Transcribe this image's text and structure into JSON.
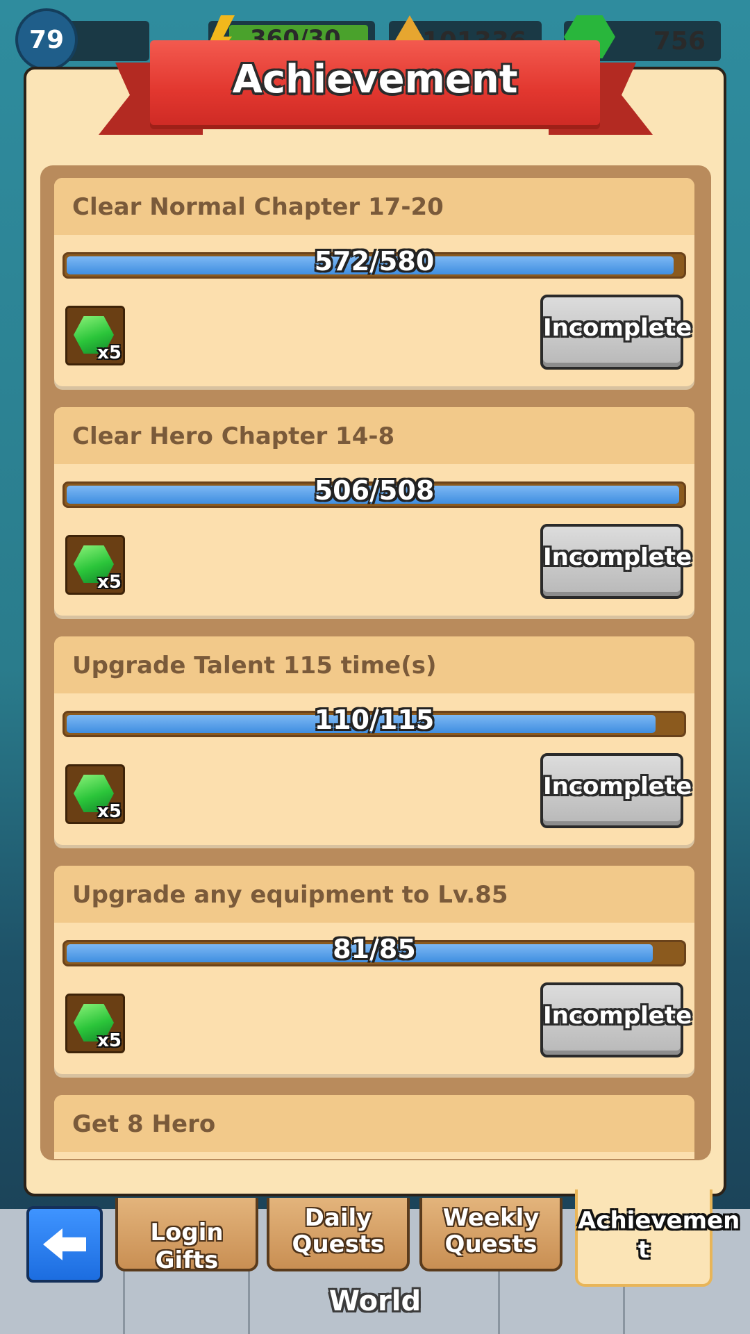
{
  "hud": {
    "level": "79",
    "energy": "360/30",
    "gold": "101336",
    "gems": "756"
  },
  "panel": {
    "title": "Achievement"
  },
  "achievements": [
    {
      "title": "Clear Normal Chapter 17-20",
      "progress_text": "572/580",
      "progress_fraction": 0.986,
      "reward_count": "x5",
      "status": "Incomplete"
    },
    {
      "title": "Clear Hero Chapter 14-8",
      "progress_text": "506/508",
      "progress_fraction": 0.996,
      "reward_count": "x5",
      "status": "Incomplete"
    },
    {
      "title": "Upgrade Talent 115 time(s)",
      "progress_text": "110/115",
      "progress_fraction": 0.957,
      "reward_count": "x5",
      "status": "Incomplete"
    },
    {
      "title": "Upgrade any equipment to Lv.85",
      "progress_text": "81/85",
      "progress_fraction": 0.953,
      "reward_count": "x5",
      "status": "Incomplete"
    },
    {
      "title": "Get 8 Hero"
    }
  ],
  "tabs": {
    "login_gifts": "Login Gifts",
    "daily_quests": "Daily\nQuests",
    "weekly_quests": "Weekly\nQuests",
    "achievement": "Achievemen\nt"
  },
  "bottom_nav": {
    "world_label": "World"
  },
  "colors": {
    "panel_bg": "#fbe4b6",
    "ribbon_red": "#e2372f",
    "progress_blue": "#3f8ee0",
    "gem_green": "#2bc53a",
    "back_blue": "#1c6de0"
  },
  "icons": {
    "back": "back-arrow-icon",
    "reward": "gem-icon"
  }
}
